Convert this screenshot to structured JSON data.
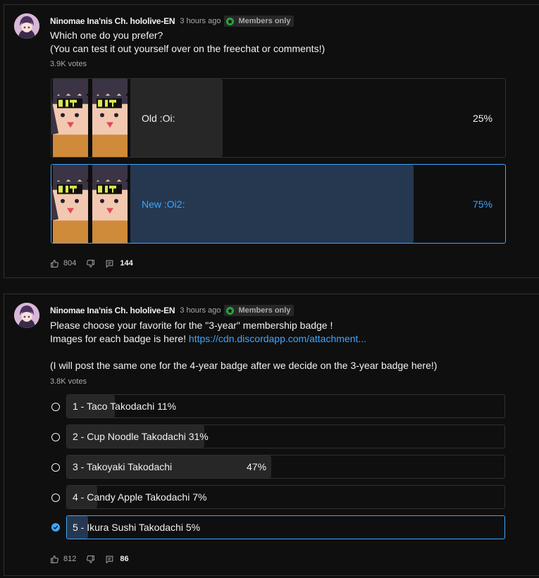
{
  "posts": [
    {
      "author": "Ninomae Ina'nis Ch. hololive-EN",
      "time": "3 hours ago",
      "badge": "Members only",
      "text_lines": [
        "Which one do you prefer?",
        "(You can test it out yourself over on the freechat or comments!)"
      ],
      "votes": "3.9K votes",
      "options": [
        {
          "label": "Old :Oi:",
          "percent": "25%",
          "fraction": 0.25,
          "selected": false
        },
        {
          "label": "New :Oi2:",
          "percent": "75%",
          "fraction": 0.75,
          "selected": true
        }
      ],
      "likes": "804",
      "comments": "144"
    },
    {
      "author": "Ninomae Ina'nis Ch. hololive-EN",
      "time": "3 hours ago",
      "badge": "Members only",
      "text_line1": "Please choose your favorite for the \"3-year\" membership badge !",
      "text_line2_prefix": "Images for each badge is here! ",
      "link": "https://cdn.discordapp.com/attachment...",
      "text_line4": "(I will post the same one for the 4-year badge after we decide on the 3-year badge here!)",
      "votes": "3.8K votes",
      "options": [
        {
          "label": "1 - Taco Takodachi  11%",
          "fraction": 0.11,
          "selected": false
        },
        {
          "label": "2 - Cup Noodle Takodachi  31%",
          "fraction": 0.31,
          "selected": false
        },
        {
          "label": "3 - Takoyaki Takodachi",
          "percent": "47%",
          "fraction": 0.47,
          "selected": false
        },
        {
          "label": "4 - Candy Apple Takodachi  7%",
          "fraction": 0.07,
          "selected": false
        },
        {
          "label": "5 - Ikura Sushi Takodachi  5%",
          "fraction": 0.05,
          "selected": true
        }
      ],
      "likes": "812",
      "comments": "86"
    }
  ],
  "colors": {
    "accent": "#3ea6ff",
    "members_badge": "#2ba640",
    "bar": "#272727",
    "bar_selected": "#263850"
  },
  "icons": [
    "thumbs-up-icon",
    "thumbs-down-icon",
    "comment-icon",
    "radio-icon",
    "checked-icon"
  ]
}
